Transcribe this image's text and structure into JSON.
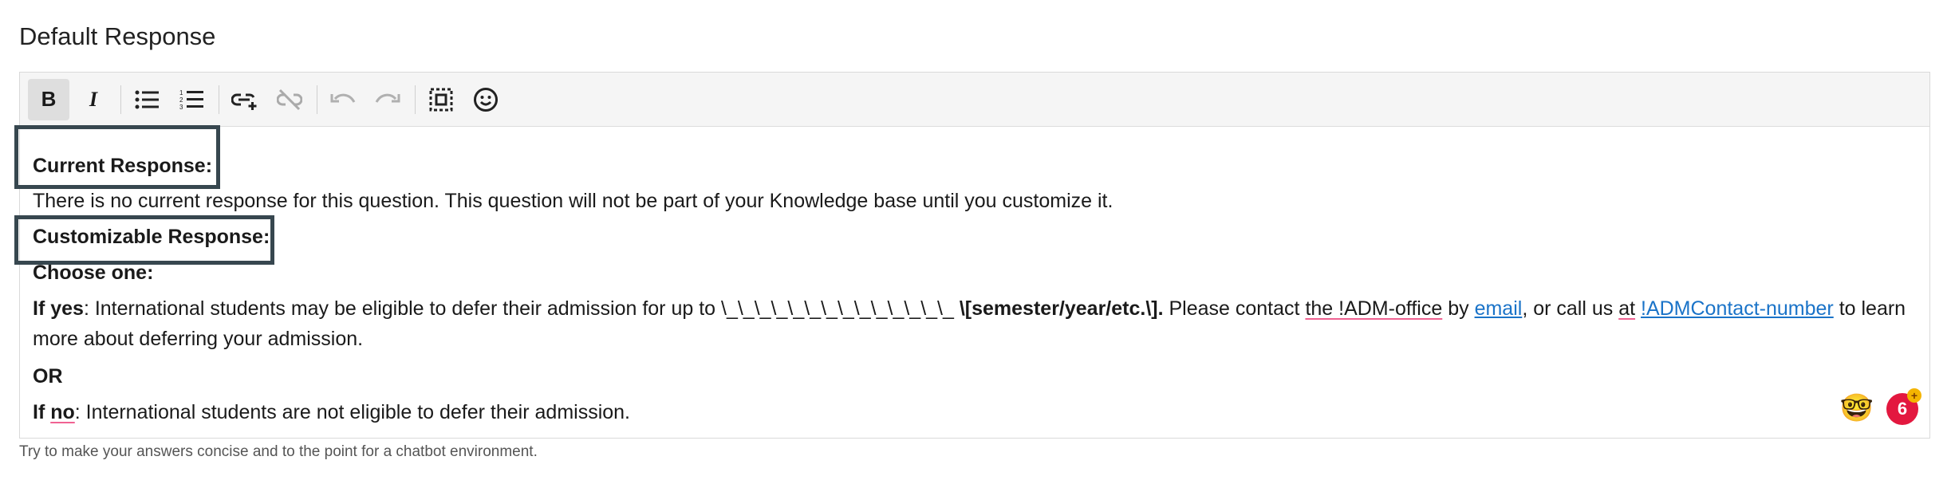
{
  "header": {
    "title": "Default Response"
  },
  "toolbar": {
    "buttons": [
      {
        "name": "bold",
        "label": "B"
      },
      {
        "name": "italic",
        "label": "I"
      }
    ]
  },
  "content": {
    "current_heading": "Current Response:",
    "current_text": "There is no current response for this question. This question will not be part of your Knowledge base until you customize it.",
    "customizable_heading": "Customizable Response:",
    "choose": "Choose one:",
    "if_yes_label": "If yes",
    "if_yes_text1": ": International students may be eligible to defer their admission for up to \\_\\_\\_\\_\\_\\_\\_\\_\\_\\_\\_\\_\\_\\_ ",
    "if_yes_bold": "\\[semester/year/etc.\\].",
    "if_yes_text2": " Please contact ",
    "the_adm_office": "the !ADM-office",
    "by": " by ",
    "email_link": "email",
    "call_us": ", or call us ",
    "at": "at",
    "contact_link": "!ADMContact-number",
    "to_learn": " to learn",
    "more_about": "more about deferring your admission.",
    "or": "OR",
    "if_no_label_if": "If ",
    "if_no_label_no": "no",
    "if_no_text": ": International students are not eligible to defer their admission."
  },
  "helper_text": "Try to make your answers concise and to the point for a chatbot environment.",
  "floating": {
    "emoji": "🤓",
    "badge_count": "6",
    "badge_plus": "+"
  }
}
